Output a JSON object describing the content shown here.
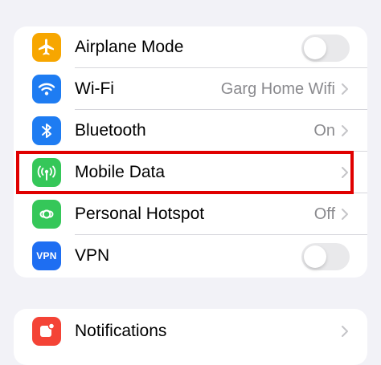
{
  "settings": {
    "airplane_mode": {
      "label": "Airplane Mode",
      "toggle_on": false,
      "icon": "airplane-icon",
      "color": "#f7a600"
    },
    "wifi": {
      "label": "Wi-Fi",
      "value": "Garg Home Wifi",
      "icon": "wifi-icon",
      "color": "#1e7cf2"
    },
    "bluetooth": {
      "label": "Bluetooth",
      "value": "On",
      "icon": "bluetooth-icon",
      "color": "#1e7cf2"
    },
    "mobile_data": {
      "label": "Mobile Data",
      "icon": "antenna-icon",
      "color": "#35c759"
    },
    "personal_hotspot": {
      "label": "Personal Hotspot",
      "value": "Off",
      "icon": "hotspot-icon",
      "color": "#35c759"
    },
    "vpn": {
      "label": "VPN",
      "icon_text": "VPN",
      "toggle_on": false,
      "color": "#1e6ef2"
    }
  },
  "notifications": {
    "label": "Notifications",
    "icon": "bell-icon",
    "color": "#f44336"
  },
  "highlight": {
    "target": "mobile_data",
    "color": "#e00000"
  }
}
